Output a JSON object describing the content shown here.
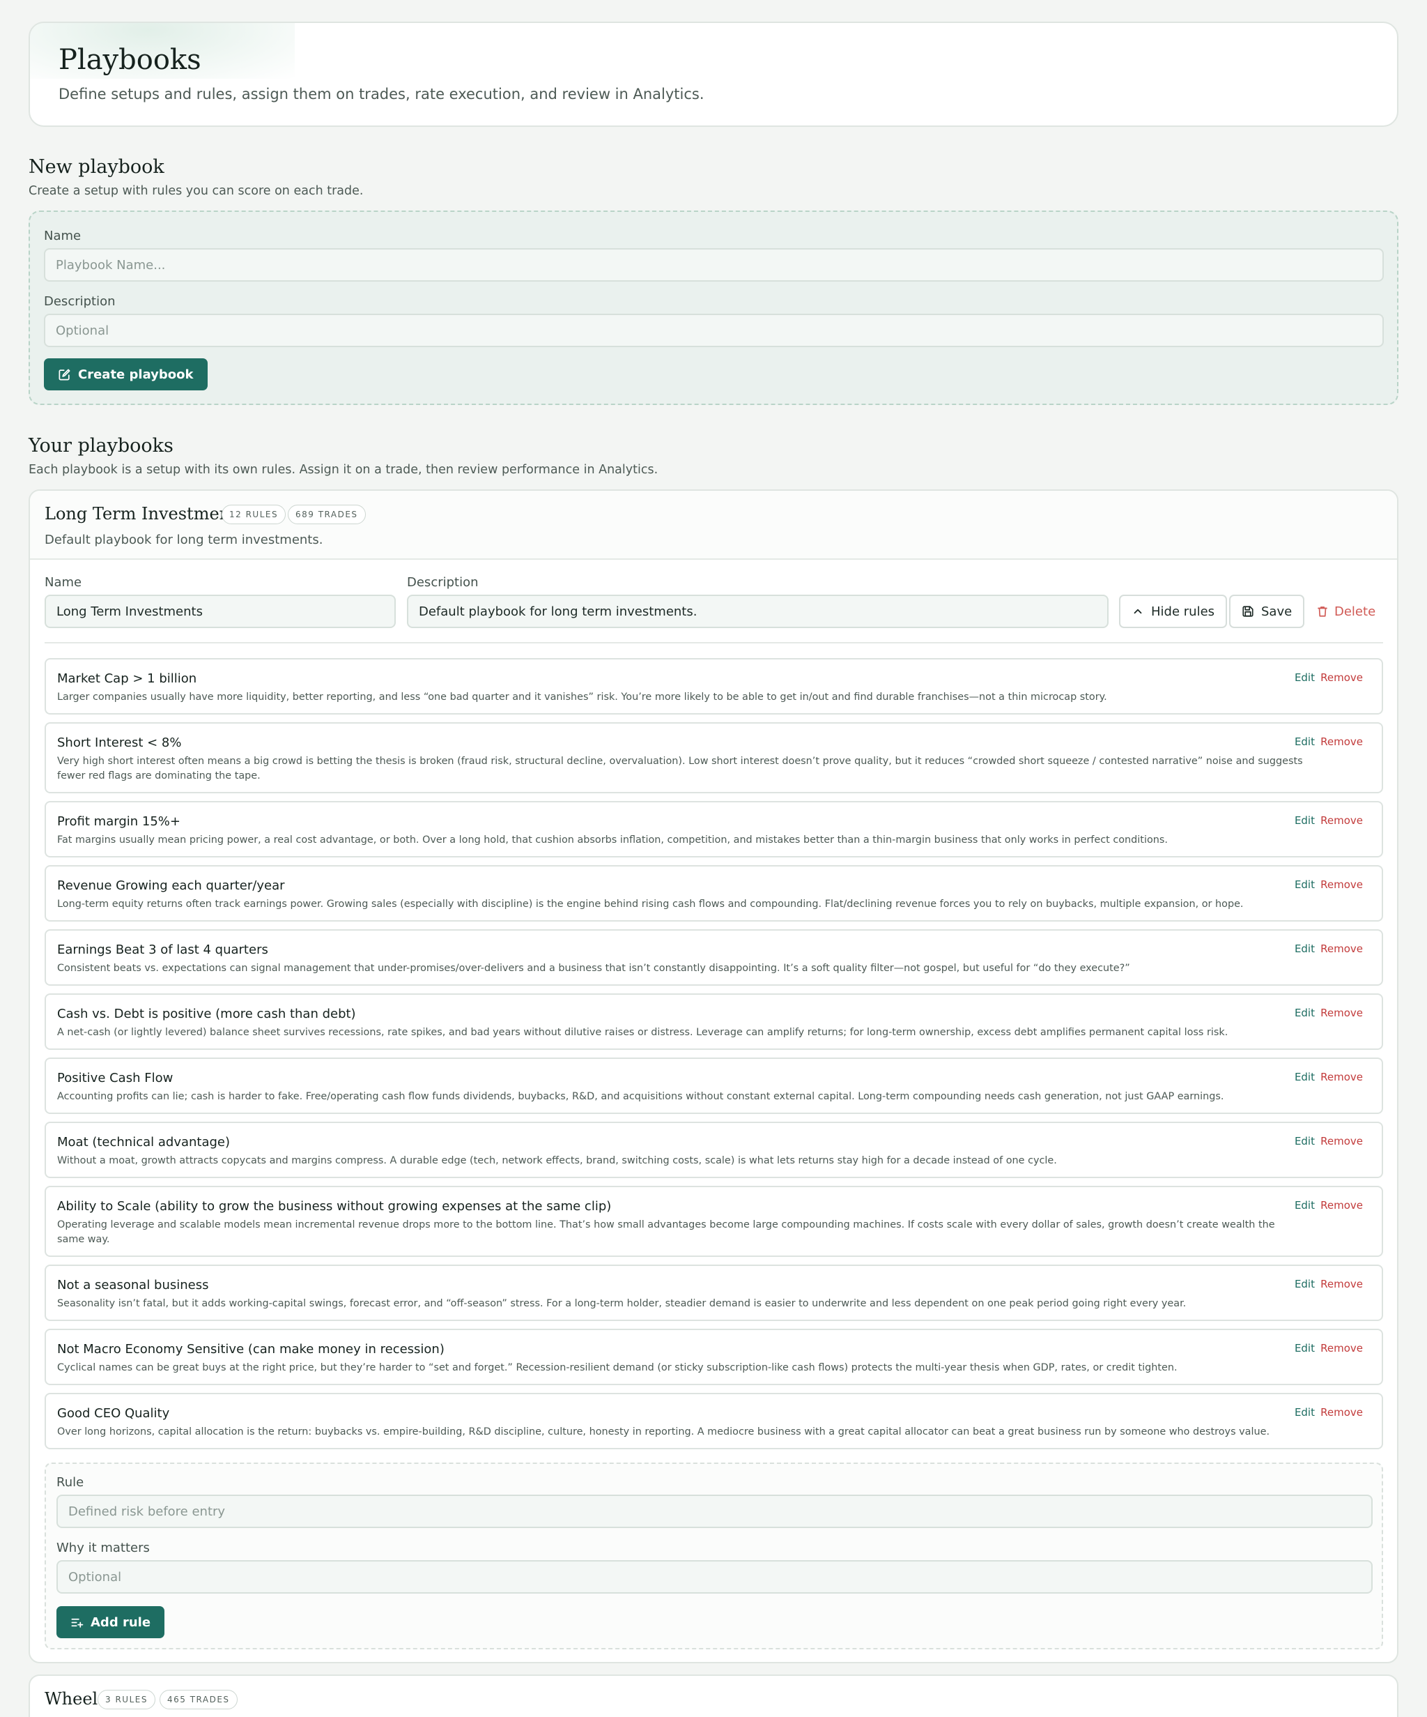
{
  "header": {
    "title": "Playbooks",
    "subtitle": "Define setups and rules, assign them on trades, rate execution, and review in Analytics."
  },
  "new_playbook": {
    "title": "New playbook",
    "subtitle": "Create a setup with rules you can score on each trade.",
    "name_label": "Name",
    "name_placeholder": "Playbook Name...",
    "description_label": "Description",
    "description_placeholder": "Optional",
    "create_button": "Create playbook",
    "create_icon": "edit-square-icon"
  },
  "your_playbooks": {
    "title": "Your playbooks",
    "subtitle": "Each playbook is a setup with its own rules. Assign it on a trade, then review performance in Analytics."
  },
  "playbook": {
    "title": "Long Term Investments",
    "rules_badge": "12 RULES",
    "trades_badge": "689 TRADES",
    "description": "Default playbook for long term investments.",
    "name_label": "Name",
    "name_value": "Long Term Investments",
    "description_label": "Description",
    "description_value": "Default playbook for long term investments.",
    "hide_rules_button": "Hide rules",
    "save_button": "Save",
    "delete_button": "Delete",
    "edit_label": "Edit",
    "remove_label": "Remove",
    "rules": [
      {
        "title": "Market Cap > 1 billion",
        "body": "Larger companies usually have more liquidity, better reporting, and less “one bad quarter and it vanishes” risk. You’re more likely to be able to get in/out and find durable franchises—not a thin microcap story."
      },
      {
        "title": "Short Interest < 8%",
        "body": "Very high short interest often means a big crowd is betting the thesis is broken (fraud risk, structural decline, overvaluation). Low short interest doesn’t prove quality, but it reduces “crowded short squeeze / contested narrative” noise and suggests fewer red flags are dominating the tape."
      },
      {
        "title": "Profit margin 15%+",
        "body": "Fat margins usually mean pricing power, a real cost advantage, or both. Over a long hold, that cushion absorbs inflation, competition, and mistakes better than a thin-margin business that only works in perfect conditions."
      },
      {
        "title": "Revenue Growing each quarter/year",
        "body": "Long-term equity returns often track earnings power. Growing sales (especially with discipline) is the engine behind rising cash flows and compounding. Flat/declining revenue forces you to rely on buybacks, multiple expansion, or hope."
      },
      {
        "title": "Earnings Beat 3 of last 4 quarters",
        "body": "Consistent beats vs. expectations can signal management that under-promises/over-delivers and a business that isn’t constantly disappointing. It’s a soft quality filter—not gospel, but useful for “do they execute?”"
      },
      {
        "title": "Cash vs. Debt is positive (more cash than debt)",
        "body": "A net-cash (or lightly levered) balance sheet survives recessions, rate spikes, and bad years without dilutive raises or distress. Leverage can amplify returns; for long-term ownership, excess debt amplifies permanent capital loss risk."
      },
      {
        "title": "Positive Cash Flow",
        "body": "Accounting profits can lie; cash is harder to fake. Free/operating cash flow funds dividends, buybacks, R&D, and acquisitions without constant external capital. Long-term compounding needs cash generation, not just GAAP earnings."
      },
      {
        "title": "Moat (technical advantage)",
        "body": "Without a moat, growth attracts copycats and margins compress. A durable edge (tech, network effects, brand, switching costs, scale) is what lets returns stay high for a decade instead of one cycle."
      },
      {
        "title": "Ability to Scale (ability to grow the business without growing expenses at the same clip)",
        "body": "Operating leverage and scalable models mean incremental revenue drops more to the bottom line. That’s how small advantages become large compounding machines. If costs scale with every dollar of sales, growth doesn’t create wealth the same way."
      },
      {
        "title": "Not a seasonal business",
        "body": "Seasonality isn’t fatal, but it adds working-capital swings, forecast error, and “off-season” stress. For a long-term holder, steadier demand is easier to underwrite and less dependent on one peak period going right every year."
      },
      {
        "title": "Not Macro Economy Sensitive (can make money in recession)",
        "body": "Cyclical names can be great buys at the right price, but they’re harder to “set and forget.” Recession-resilient demand (or sticky subscription-like cash flows) protects the multi-year thesis when GDP, rates, or credit tighten."
      },
      {
        "title": "Good CEO Quality",
        "body": "Over long horizons, capital allocation is the return: buybacks vs. empire-building, R&D discipline, culture, honesty in reporting. A mediocre business with a great capital allocator can beat a great business run by someone who destroys value."
      }
    ],
    "add_rule": {
      "rule_label": "Rule",
      "rule_placeholder": "Defined risk before entry",
      "why_label": "Why it matters",
      "why_placeholder": "Optional",
      "add_button": "Add rule"
    }
  },
  "playbook2": {
    "title": "Wheel",
    "rules_badge": "3 RULES",
    "trades_badge": "465 TRADES"
  },
  "colors": {
    "accent": "#1e6d62",
    "danger": "#c23b3b",
    "background": "#f3f5f3"
  }
}
